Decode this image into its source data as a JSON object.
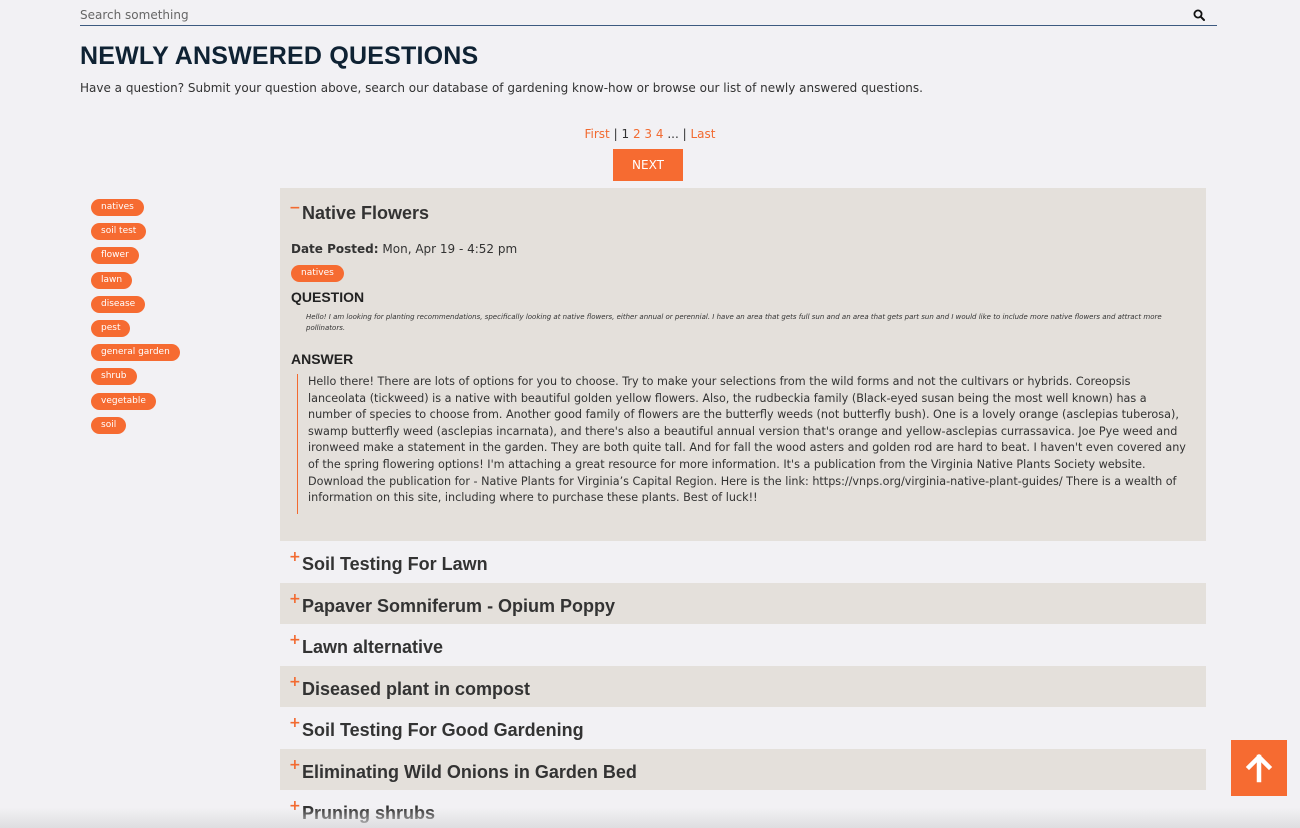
{
  "search": {
    "placeholder": "Search something"
  },
  "header": {
    "title": "NEWLY ANSWERED QUESTIONS",
    "intro": "Have a question? Submit your question above, search our database of gardening know-how or browse our list of newly answered questions."
  },
  "pagination": {
    "first": "First",
    "separator": "|",
    "current": "1",
    "pages": [
      "2",
      "3",
      "4"
    ],
    "ellipsis": "...",
    "last": "Last",
    "next": "NEXT"
  },
  "tags": [
    "natives",
    "soil test",
    "flower",
    "lawn",
    "disease",
    "pest",
    "general garden",
    "shrub",
    "vegetable",
    "soil"
  ],
  "open_item": {
    "toggle": "−",
    "title": "Native Flowers",
    "date_label": "Date Posted:",
    "date_value": "Mon, Apr 19 - 4:52 pm",
    "tag": "natives",
    "question_heading": "QUESTION",
    "question": "Hello! I am looking for planting recommendations, specifically looking at native flowers, either annual or perennial. I have an area that gets full sun and an area that gets part sun and I would like to include more native flowers and attract more pollinators.",
    "answer_heading": "ANSWER",
    "answer": "Hello there! There are lots of options for you to choose. Try to make your selections from the wild forms and not the cultivars or hybrids. Coreopsis lanceolata (tickweed) is a native with beautiful golden yellow flowers. Also, the rudbeckia family (Black-eyed susan being the most well known) has a number of species to choose from. Another good family of flowers are the butterfly weeds (not butterfly bush). One is a lovely orange (asclepias tuberosa), swamp butterfly weed (asclepias incarnata), and there's also a beautiful annual version that's orange and yellow-asclepias currassavica. Joe Pye weed and ironweed make a statement in the garden. They are both quite tall. And for fall the wood asters and golden rod are hard to beat. I haven't even covered any of the spring flowering options! I'm attaching a great resource for more information. It's a publication from the Virginia Native Plants Society website. Download the publication for - Native Plants for Virginia’s Capital Region. Here is the link: https://vnps.org/virginia-native-plant-guides/ There is a wealth of information on this site, including where to purchase these plants. Best of luck!!"
  },
  "collapsed_toggle": "+",
  "collapsed_items": [
    "Soil Testing For Lawn",
    "Papaver Somniferum - Opium Poppy",
    "Lawn alternative",
    "Diseased plant in compost",
    "Soil Testing For Good Gardening",
    "Eliminating Wild Onions in Garden Bed",
    "Pruning shrubs"
  ],
  "colors": {
    "accent": "#f66b31",
    "title": "#0f2233",
    "panel": "#e4e0db",
    "background": "#f2f1f4"
  },
  "icons": {
    "search": "search-icon",
    "back_to_top": "arrow-up-icon"
  }
}
